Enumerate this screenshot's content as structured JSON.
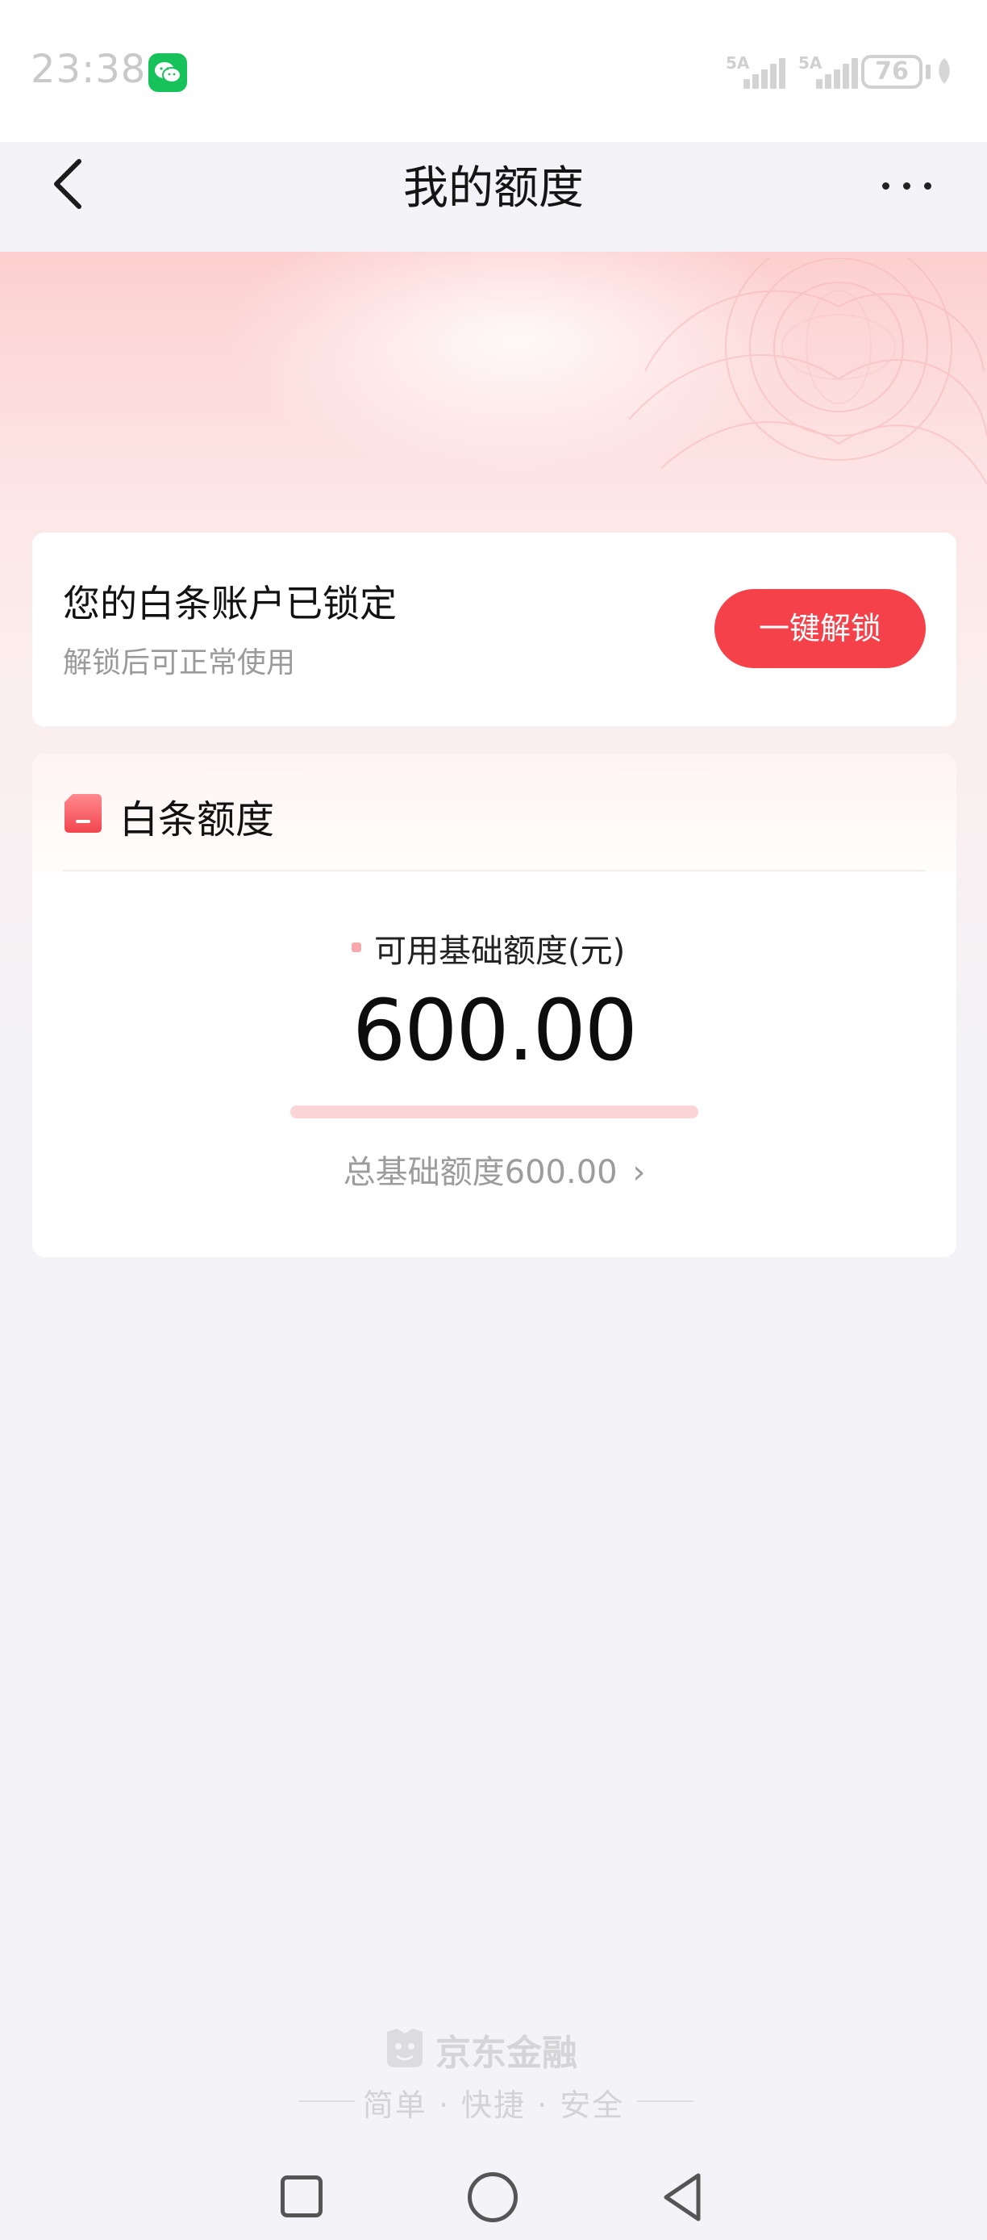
{
  "status_bar": {
    "time": "23:38",
    "signal1_label": "5A",
    "signal2_label": "5A",
    "battery": "76",
    "notification_icon": "wechat-icon"
  },
  "header": {
    "title": "我的额度",
    "back_icon": "chevron-left-icon",
    "more_icon": "more-dots-icon"
  },
  "lock_notice": {
    "title": "您的白条账户已锁定",
    "subtitle": "解锁后可正常使用",
    "button_label": "一键解锁"
  },
  "quota_card": {
    "title": "白条额度",
    "available_label": "可用基础额度(元)",
    "available_amount": "600.00",
    "usage_fraction": 0.0,
    "total_label": "总基础额度600.00",
    "total_chevron": "›"
  },
  "footer": {
    "brand": "京东金融",
    "slogan": "简单 · 快捷 · 安全"
  },
  "colors": {
    "accent": "#f5424a",
    "bar_track": "#fbd4d5",
    "page_background": "#f4f3f7"
  }
}
